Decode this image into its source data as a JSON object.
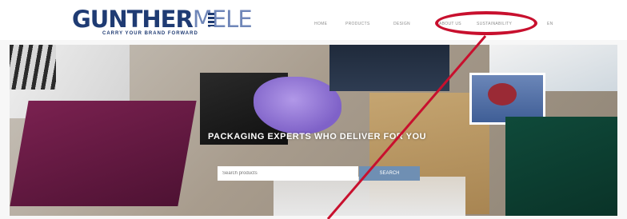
{
  "brand": {
    "logo_bold": "GUNTHER",
    "logo_light": "MELE",
    "tagline": "CARRY YOUR BRAND FORWARD"
  },
  "nav": {
    "items": [
      {
        "label": "HOME"
      },
      {
        "label": "PRODUCTS"
      },
      {
        "label": "DESIGN"
      },
      {
        "label": "ABOUT US"
      },
      {
        "label": "SUSTAINABILITY"
      },
      {
        "label": "EN"
      }
    ]
  },
  "hero": {
    "headline": "PACKAGING EXPERTS WHO DELIVER FOR YOU"
  },
  "search": {
    "placeholder": "Search products",
    "button_label": "SEARCH"
  },
  "colors": {
    "brand_dark": "#1f3b73",
    "brand_light": "#6f86b8",
    "annotation_red": "#c8102e"
  }
}
